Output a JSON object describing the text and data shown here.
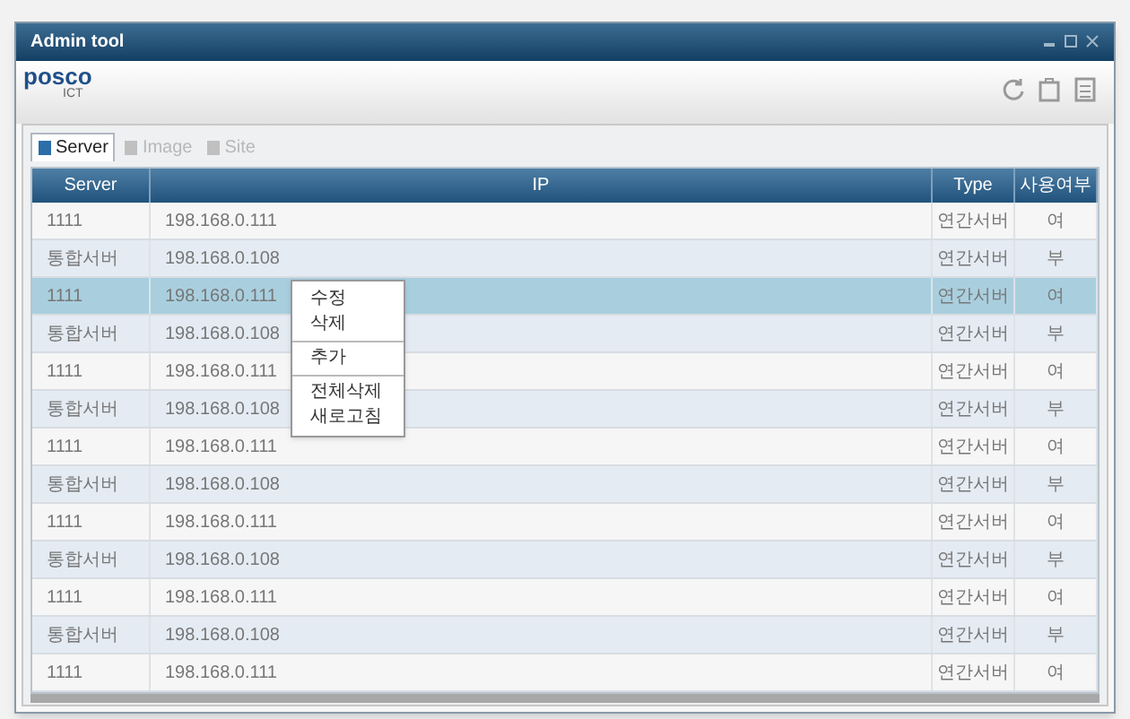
{
  "window": {
    "title": "Admin tool"
  },
  "logo": {
    "name": "posco",
    "sub": "ICT"
  },
  "tabs": [
    {
      "label": "Server",
      "selected": true
    },
    {
      "label": "Image",
      "selected": false
    },
    {
      "label": "Site",
      "selected": false
    }
  ],
  "table": {
    "columns": [
      "Server",
      "IP",
      "Type",
      "사용여부"
    ],
    "rows": [
      {
        "cells": [
          "1111",
          "198.168.0.111",
          "연간서버",
          "여"
        ],
        "selected": false
      },
      {
        "cells": [
          "통합서버",
          "198.168.0.108",
          "연간서버",
          "부"
        ],
        "selected": false
      },
      {
        "cells": [
          "1111",
          "198.168.0.111",
          "연간서버",
          "여"
        ],
        "selected": true
      },
      {
        "cells": [
          "통합서버",
          "198.168.0.108",
          "연간서버",
          "부"
        ],
        "selected": false
      },
      {
        "cells": [
          "1111",
          "198.168.0.111",
          "연간서버",
          "여"
        ],
        "selected": false
      },
      {
        "cells": [
          "통합서버",
          "198.168.0.108",
          "연간서버",
          "부"
        ],
        "selected": false
      },
      {
        "cells": [
          "1111",
          "198.168.0.111",
          "연간서버",
          "여"
        ],
        "selected": false
      },
      {
        "cells": [
          "통합서버",
          "198.168.0.108",
          "연간서버",
          "부"
        ],
        "selected": false
      },
      {
        "cells": [
          "1111",
          "198.168.0.111",
          "연간서버",
          "여"
        ],
        "selected": false
      },
      {
        "cells": [
          "통합서버",
          "198.168.0.108",
          "연간서버",
          "부"
        ],
        "selected": false
      },
      {
        "cells": [
          "1111",
          "198.168.0.111",
          "연간서버",
          "여"
        ],
        "selected": false
      },
      {
        "cells": [
          "통합서버",
          "198.168.0.108",
          "연간서버",
          "부"
        ],
        "selected": false
      },
      {
        "cells": [
          "1111",
          "198.168.0.111",
          "연간서버",
          "여"
        ],
        "selected": false
      }
    ]
  },
  "context_menu": {
    "groups": [
      [
        "수정",
        "삭제"
      ],
      [
        "추가"
      ],
      [
        "전체삭제",
        "새로고침"
      ]
    ]
  }
}
